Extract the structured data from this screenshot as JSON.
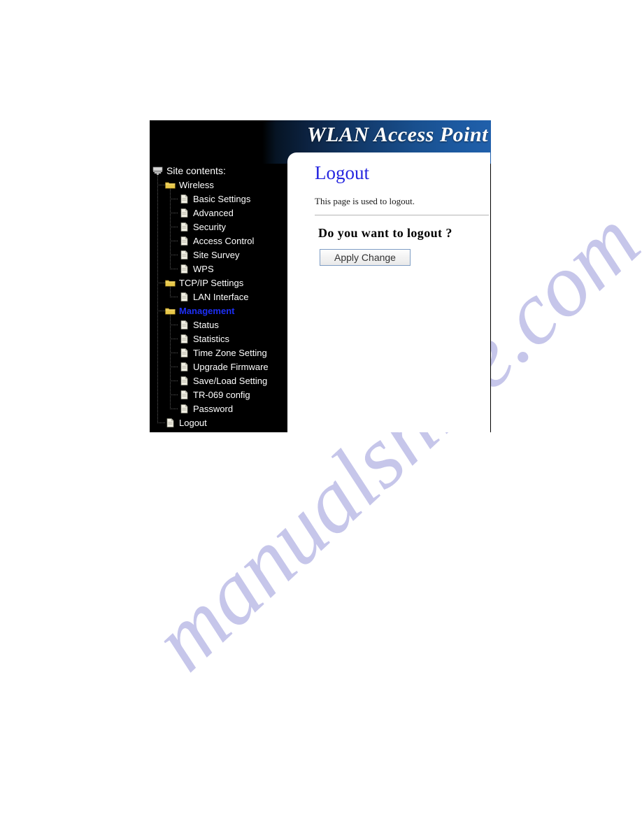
{
  "watermark": {
    "text": "manualshive.com"
  },
  "header": {
    "title": "WLAN Access Point"
  },
  "sidebar": {
    "root_label": "Site contents:",
    "root_icon": "computer-icon",
    "items": [
      {
        "label": "Wireless",
        "level": 1,
        "icon": "folder-icon",
        "selected": false
      },
      {
        "label": "Basic Settings",
        "level": 2,
        "icon": "page-icon",
        "selected": false
      },
      {
        "label": "Advanced",
        "level": 2,
        "icon": "page-icon",
        "selected": false
      },
      {
        "label": "Security",
        "level": 2,
        "icon": "page-icon",
        "selected": false
      },
      {
        "label": "Access Control",
        "level": 2,
        "icon": "page-icon",
        "selected": false
      },
      {
        "label": "Site Survey",
        "level": 2,
        "icon": "page-icon",
        "selected": false
      },
      {
        "label": "WPS",
        "level": 2,
        "icon": "page-icon",
        "selected": false
      },
      {
        "label": "TCP/IP Settings",
        "level": 1,
        "icon": "folder-icon",
        "selected": false
      },
      {
        "label": "LAN Interface",
        "level": 2,
        "icon": "page-icon",
        "selected": false
      },
      {
        "label": "Management",
        "level": 1,
        "icon": "folder-icon",
        "selected": true
      },
      {
        "label": "Status",
        "level": 2,
        "icon": "page-icon",
        "selected": false
      },
      {
        "label": "Statistics",
        "level": 2,
        "icon": "page-icon",
        "selected": false
      },
      {
        "label": "Time Zone Setting",
        "level": 2,
        "icon": "page-icon",
        "selected": false
      },
      {
        "label": "Upgrade Firmware",
        "level": 2,
        "icon": "page-icon",
        "selected": false
      },
      {
        "label": "Save/Load Setting",
        "level": 2,
        "icon": "page-icon",
        "selected": false
      },
      {
        "label": "TR-069 config",
        "level": 2,
        "icon": "page-icon",
        "selected": false
      },
      {
        "label": "Password",
        "level": 2,
        "icon": "page-icon",
        "selected": false
      },
      {
        "label": "Logout",
        "level": 1,
        "icon": "page-icon",
        "selected": false
      }
    ]
  },
  "main": {
    "heading": "Logout",
    "description": "This page is used to logout.",
    "question": "Do you want to logout ?",
    "apply_label": "Apply Change"
  },
  "colors": {
    "heading_blue": "#2626e0",
    "selected_blue": "#1d2ff5",
    "banner_navy": "#123a6b",
    "sidebar_black": "#000000",
    "watermark_lilac": "#c6c6ea",
    "folder_yellow": "#e8c84a",
    "page_white": "#f2f0e4"
  }
}
